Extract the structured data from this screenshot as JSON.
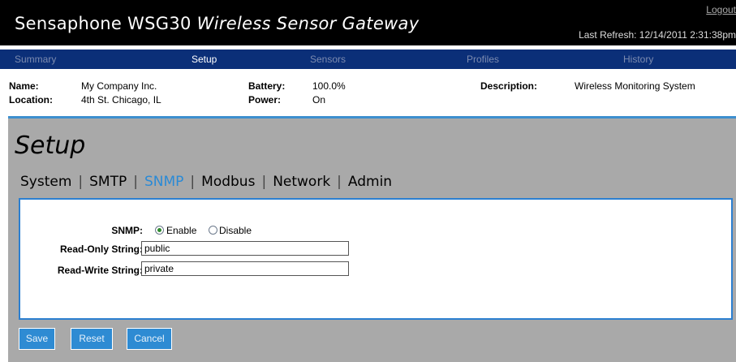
{
  "header": {
    "brand": "Sensaphone WSG30",
    "subtitle": "Wireless Sensor Gateway",
    "logout": "Logout",
    "last_refresh": "Last Refresh: 12/14/2011 2:31:38pm"
  },
  "nav": {
    "items": [
      "Summary",
      "Setup",
      "Sensors",
      "Profiles",
      "History"
    ],
    "active": "Setup"
  },
  "device": {
    "name_label": "Name:",
    "name_value": "My Company Inc.",
    "location_label": "Location:",
    "location_value": "4th St. Chicago, IL",
    "battery_label": "Battery:",
    "battery_value": "100.0%",
    "power_label": "Power:",
    "power_value": "On",
    "description_label": "Description:",
    "description_value": "Wireless Monitoring System"
  },
  "page": {
    "title": "Setup",
    "tabs": [
      "System",
      "SMTP",
      "SNMP",
      "Modbus",
      "Network",
      "Admin"
    ],
    "active_tab": "SNMP"
  },
  "form": {
    "snmp_label": "SNMP:",
    "enable_label": "Enable",
    "disable_label": "Disable",
    "snmp_selected": "Enable",
    "read_only_label": "Read-Only String:",
    "read_only_value": "public",
    "read_write_label": "Read-Write String:",
    "read_write_value": "private"
  },
  "buttons": {
    "save": "Save",
    "reset": "Reset",
    "cancel": "Cancel"
  },
  "colors": {
    "nav_bg": "#0b2f78",
    "accent": "#2e8bd3",
    "panel_bg": "#a9a9a9",
    "active_tab": "#2a8ad6"
  }
}
